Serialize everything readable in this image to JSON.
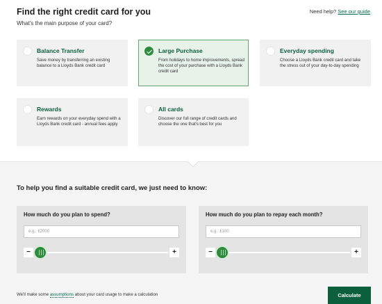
{
  "header": {
    "title": "Find the right credit card for you",
    "question": "What's the main purpose of your card?",
    "help_prefix": "Need help?",
    "help_link": "See our guide"
  },
  "cards": [
    {
      "title": "Balance Transfer",
      "desc": "Save money by transferring an existing balance to a Lloyds Bank credit card",
      "selected": false
    },
    {
      "title": "Large Purchase",
      "desc": "From holidays to home improvements, spread the cost of your purchase with a Lloyds Bank credit card",
      "selected": true
    },
    {
      "title": "Everyday spending",
      "desc": "Choose a Lloyds Bank credit card and take the stress out of your day-to-day spending",
      "selected": false
    },
    {
      "title": "Rewards",
      "desc": "Earn rewards on your everyday spend with a Lloyds Bank credit card - annual fees apply",
      "selected": false
    },
    {
      "title": "All cards",
      "desc": "Discover our full range of credit cards and choose the one that's best for you",
      "selected": false
    }
  ],
  "calculator": {
    "title": "To help you find a suitable credit card, we just need to know:",
    "spend": {
      "label": "How much do you plan to spend?",
      "placeholder": "e.g.: £2000",
      "minus": "−",
      "plus": "+"
    },
    "repay": {
      "label": "How much do you plan to repay each month?",
      "placeholder": "e.g.: £100",
      "minus": "−",
      "plus": "+"
    }
  },
  "footer": {
    "note_prefix": "We'll make some ",
    "note_link": "assumptions",
    "note_suffix": " about your card usage to make a calculation",
    "calculate_label": "Calculate"
  },
  "colors": {
    "brand_green": "#0c5f3c",
    "check_green": "#2e8b3e"
  }
}
